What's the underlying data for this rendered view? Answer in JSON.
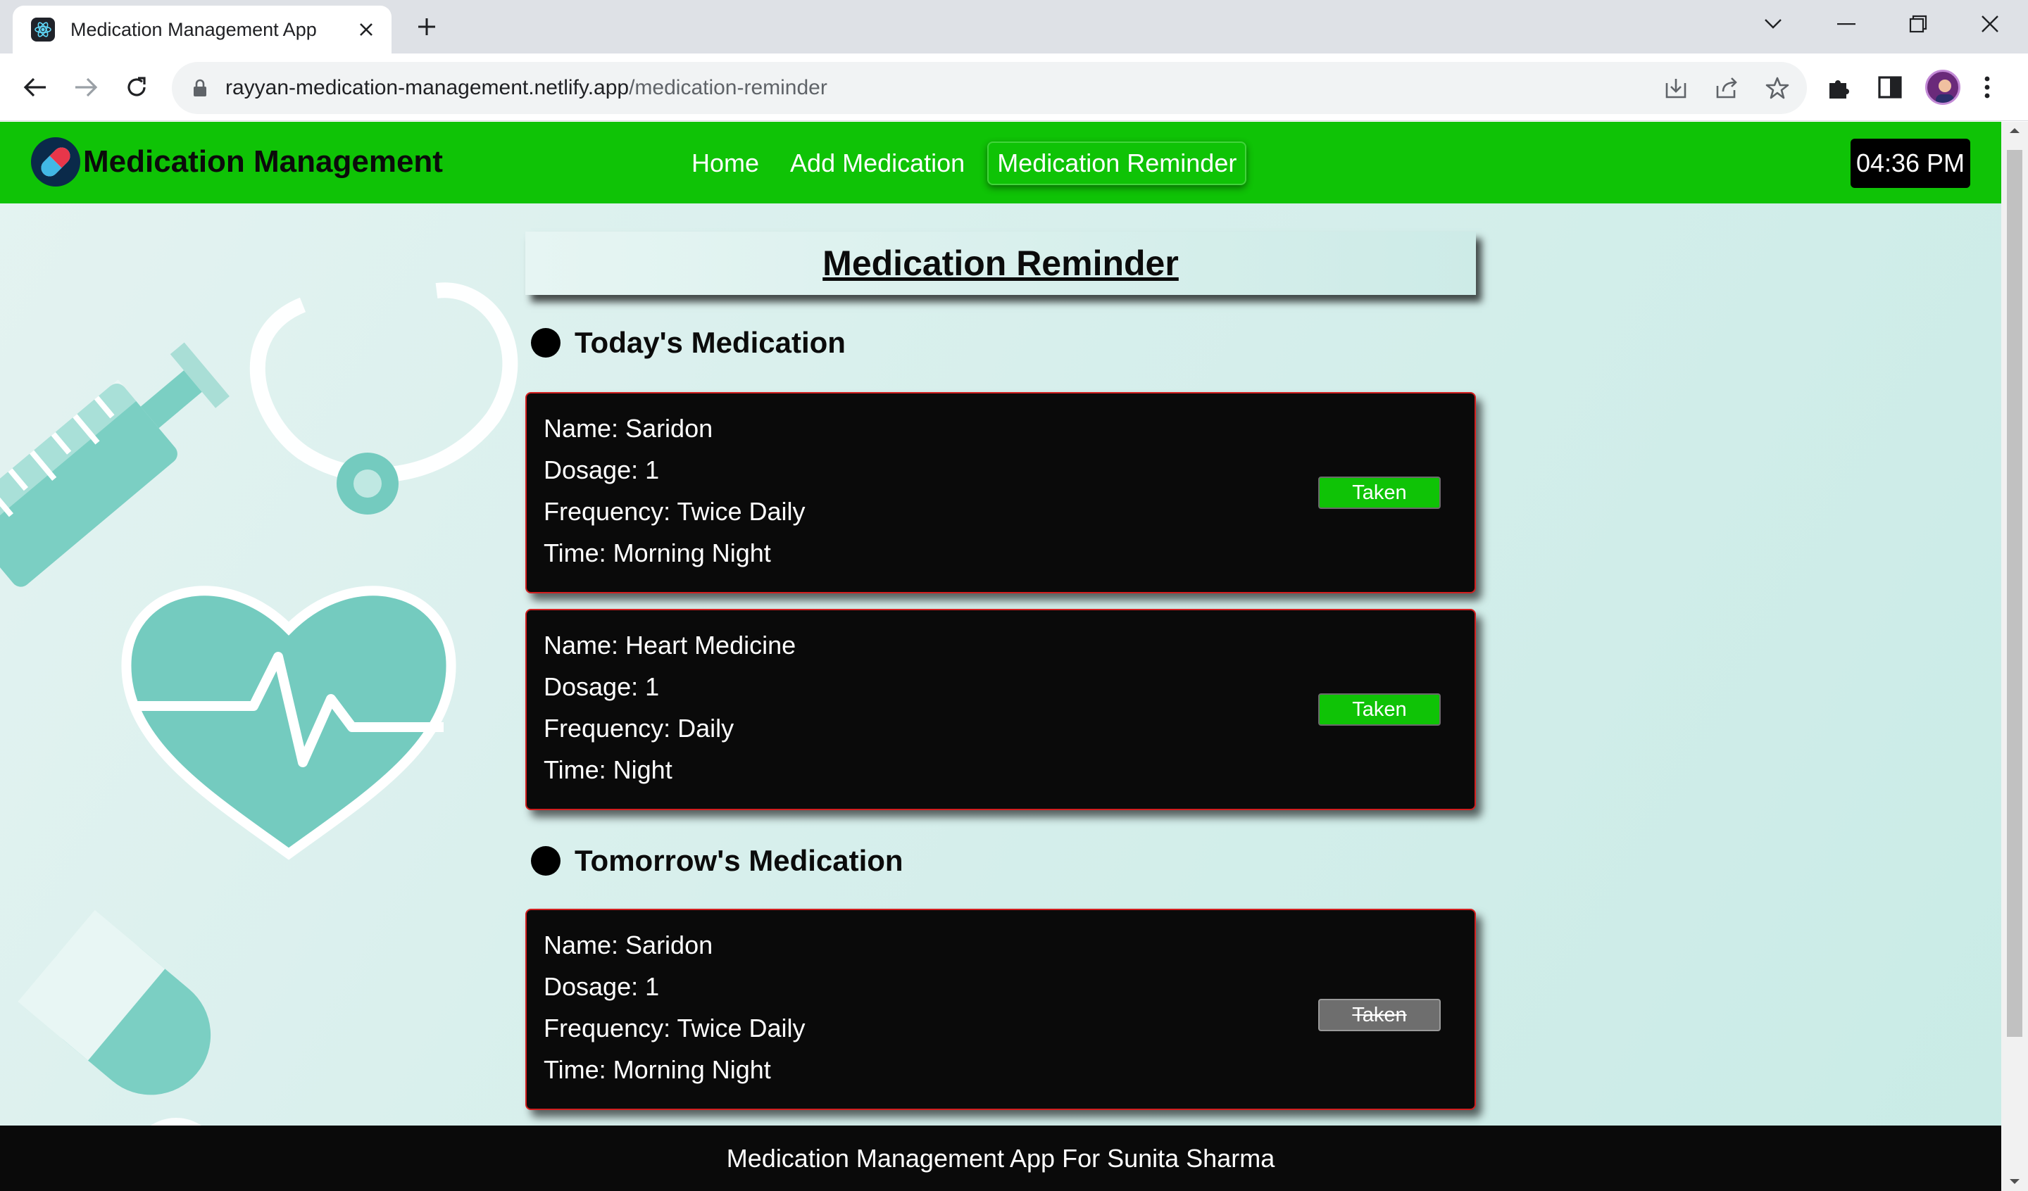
{
  "browser": {
    "tab_title": "Medication Management App",
    "url_domain": "rayyan-medication-management.netlify.app",
    "url_path": "/medication-reminder"
  },
  "app": {
    "brand": "Medication Management",
    "nav": [
      "Home",
      "Add Medication",
      "Medication Reminder"
    ],
    "active_nav": "Medication Reminder",
    "clock": "04:36 PM",
    "page_title": "Medication Reminder",
    "accent_color": "#0fc306",
    "card_border_color": "#d21f1f"
  },
  "sections": {
    "today": {
      "title": "Today's Medication",
      "cards": [
        {
          "name": "Name: Saridon",
          "dosage": "Dosage: 1",
          "frequency": "Frequency: Twice Daily",
          "time": "Time: Morning Night",
          "button": "Taken",
          "button_enabled": true
        },
        {
          "name": "Name: Heart Medicine",
          "dosage": "Dosage: 1",
          "frequency": "Frequency: Daily",
          "time": "Time: Night",
          "button": "Taken",
          "button_enabled": true
        }
      ]
    },
    "tomorrow": {
      "title": "Tomorrow's Medication",
      "cards": [
        {
          "name": "Name: Saridon",
          "dosage": "Dosage: 1",
          "frequency": "Frequency: Twice Daily",
          "time": "Time: Morning Night",
          "button": "Taken",
          "button_enabled": false
        }
      ]
    }
  },
  "footer": "Medication Management App For Sunita Sharma"
}
